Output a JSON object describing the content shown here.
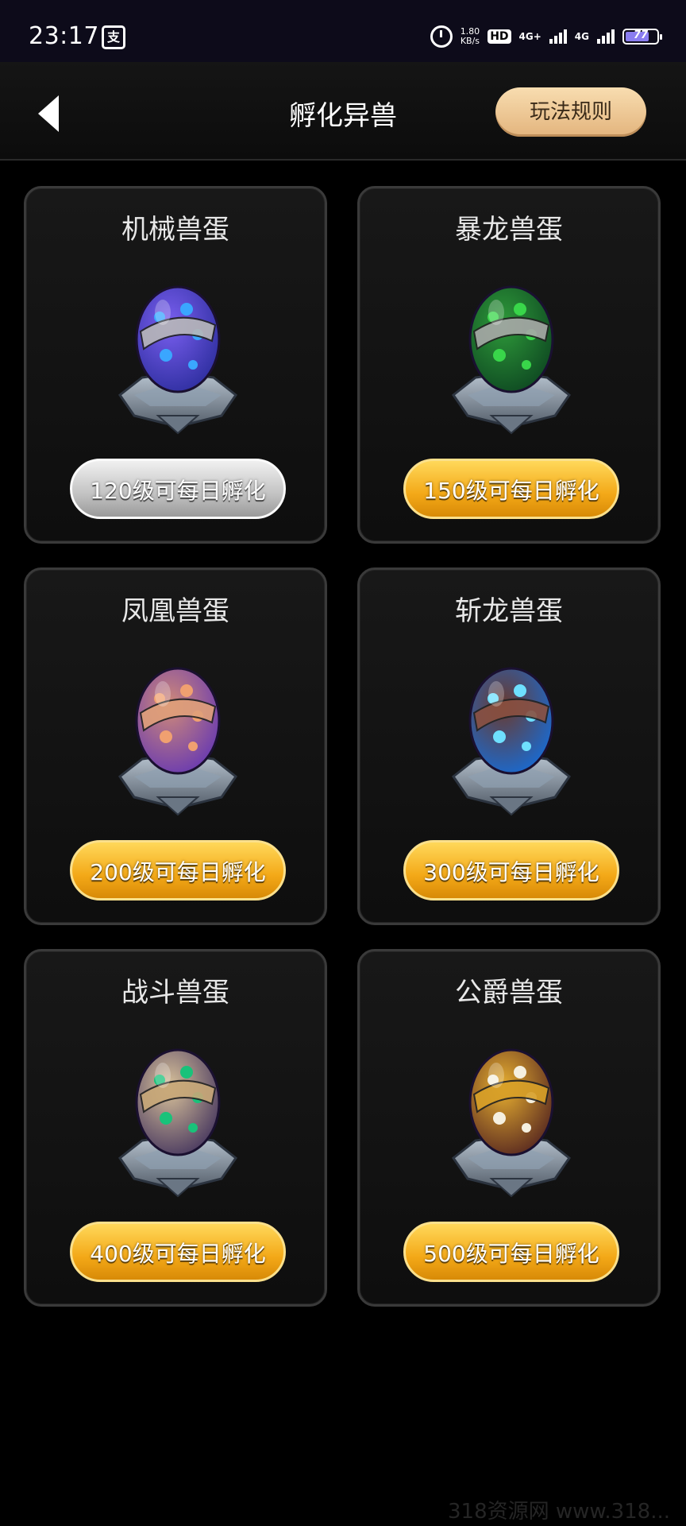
{
  "status_bar": {
    "time": "23:17",
    "app_badge": "支",
    "net_speed_value": "1.80",
    "net_speed_unit": "KB/s",
    "hd_label": "HD",
    "sim1_label": "4G+",
    "sim2_label": "4G",
    "battery_level": "77",
    "battery_color": "#8a7df0"
  },
  "header": {
    "title": "孵化异兽",
    "rules_button": "玩法规则"
  },
  "eggs": [
    {
      "name": "机械兽蛋",
      "requirement": "120级可每日孵化",
      "badge": "silver",
      "shell_colors": [
        "#2f2fa0",
        "#7a5ff0"
      ],
      "spot_color": "#3aa6ff",
      "band_color": "#b8b8b8"
    },
    {
      "name": "暴龙兽蛋",
      "requirement": "150级可每日孵化",
      "badge": "gold",
      "shell_colors": [
        "#0f4a22",
        "#2e9a3a"
      ],
      "spot_color": "#39d64a",
      "band_color": "#a8a8a8"
    },
    {
      "name": "凤凰兽蛋",
      "requirement": "200级可每日孵化",
      "badge": "gold",
      "shell_colors": [
        "#6a3bb0",
        "#d08a78"
      ],
      "spot_color": "#f0a070",
      "band_color": "#e0a07a"
    },
    {
      "name": "斩龙兽蛋",
      "requirement": "300级可每日孵化",
      "badge": "gold",
      "shell_colors": [
        "#1a6ad0",
        "#6a3a2e"
      ],
      "spot_color": "#6ee0ff",
      "band_color": "#8a5040"
    },
    {
      "name": "战斗兽蛋",
      "requirement": "400级可每日孵化",
      "badge": "gold",
      "shell_colors": [
        "#4a3a60",
        "#d9c29a"
      ],
      "spot_color": "#19c27a",
      "band_color": "#c8a878"
    },
    {
      "name": "公爵兽蛋",
      "requirement": "500级可每日孵化",
      "badge": "gold",
      "shell_colors": [
        "#5a2a20",
        "#e8b030"
      ],
      "spot_color": "#f5f0e0",
      "band_color": "#d8a028"
    }
  ],
  "watermark": "318资源网 www.318..."
}
